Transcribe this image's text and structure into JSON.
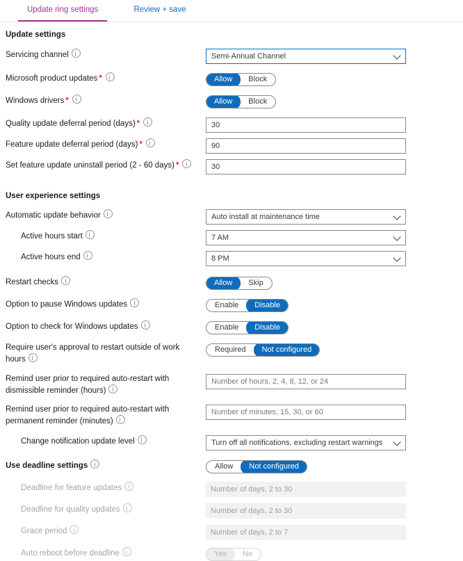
{
  "tabs": [
    {
      "label": "Update ring settings",
      "active": true
    },
    {
      "label": "Review + save",
      "active": false
    }
  ],
  "sections": {
    "update_settings": "Update settings",
    "user_experience": "User experience settings"
  },
  "colors": {
    "active_tab": "#a4358e",
    "inactive_tab": "#0f6cbd",
    "accent": "#0f6cbd",
    "required_asterisk": "#c3362b",
    "disabled_text": "#a6a6a6",
    "disabled_field_bg": "#f3f2f1"
  },
  "rows": {
    "servicing_channel": {
      "label": "Servicing channel",
      "value": "Semi-Annual Channel"
    },
    "ms_product_updates": {
      "label": "Microsoft product updates",
      "options": [
        "Allow",
        "Block"
      ],
      "selected": "Allow"
    },
    "windows_drivers": {
      "label": "Windows drivers",
      "options": [
        "Allow",
        "Block"
      ],
      "selected": "Allow"
    },
    "quality_deferral": {
      "label": "Quality update deferral period (days)",
      "value": "30"
    },
    "feature_deferral": {
      "label": "Feature update deferral period (days)",
      "value": "90"
    },
    "uninstall_period": {
      "label": "Set feature update uninstall period (2 - 60 days)",
      "value": "30"
    },
    "auto_update_behavior": {
      "label": "Automatic update behavior",
      "value": "Auto install at maintenance time"
    },
    "active_hours_start": {
      "label": "Active hours start",
      "value": "7 AM"
    },
    "active_hours_end": {
      "label": "Active hours end",
      "value": "8 PM"
    },
    "restart_checks": {
      "label": "Restart checks",
      "options": [
        "Allow",
        "Skip"
      ],
      "selected": "Allow"
    },
    "pause_updates": {
      "label": "Option to pause Windows updates",
      "options": [
        "Enable",
        "Disable"
      ],
      "selected": "Disable"
    },
    "check_updates": {
      "label": "Option to check for Windows updates",
      "options": [
        "Enable",
        "Disable"
      ],
      "selected": "Disable"
    },
    "require_approval": {
      "label": "Require user's approval to restart outside of work hours",
      "options": [
        "Required",
        "Not configured"
      ],
      "selected": "Not configured"
    },
    "dismissible_reminder": {
      "label": "Remind user prior to required auto-restart with dismissible reminder (hours)",
      "placeholder": "Number of hours, 2, 4, 8, 12, or 24"
    },
    "permanent_reminder": {
      "label": "Remind user prior to required auto-restart with permanent reminder (minutes)",
      "placeholder": "Number of minutes, 15, 30, or 60"
    },
    "notification_level": {
      "label": "Change notification update level",
      "value": "Turn off all notifications, excluding restart warnings"
    },
    "use_deadline": {
      "label": "Use deadline settings",
      "options": [
        "Allow",
        "Not configured"
      ],
      "selected": "Not configured"
    },
    "deadline_feature": {
      "label": "Deadline for feature updates",
      "placeholder": "Number of days, 2 to 30"
    },
    "deadline_quality": {
      "label": "Deadline for quality updates",
      "placeholder": "Number of days, 2 to 30"
    },
    "grace_period": {
      "label": "Grace period",
      "placeholder": "Number of days, 2 to 7"
    },
    "auto_reboot": {
      "label": "Auto reboot before deadline",
      "options": [
        "Yes",
        "No"
      ],
      "selected": "Yes"
    }
  }
}
